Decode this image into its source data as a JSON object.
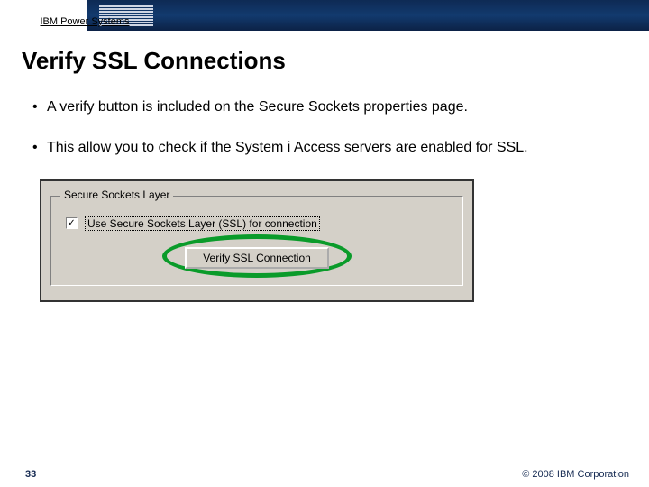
{
  "header": {
    "brand": "IBM Power Systems",
    "logo_name": "ibm-logo"
  },
  "title": "Verify SSL Connections",
  "bullets": [
    "A verify button is included on the Secure Sockets properties page.",
    "This allow you to check if the System i Access servers are enabled for SSL."
  ],
  "dialog": {
    "group_legend": "Secure Sockets Layer",
    "checkbox_checked": true,
    "checkbox_mark": "✓",
    "checkbox_label": "Use Secure Sockets Layer (SSL) for connection",
    "verify_button": "Verify SSL Connection"
  },
  "footer": {
    "page": "33",
    "copyright": "© 2008 IBM Corporation"
  }
}
